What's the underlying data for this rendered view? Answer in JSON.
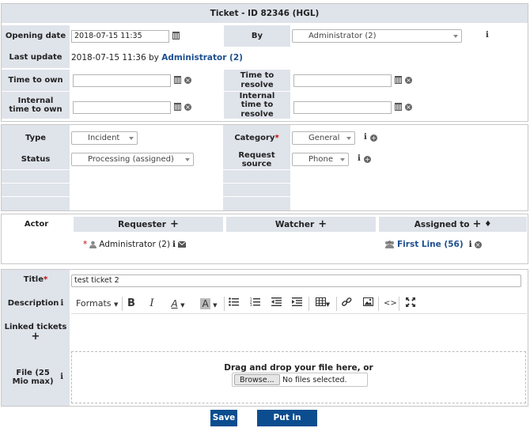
{
  "ticket": {
    "header": "Ticket - ID 82346 (HGL)"
  },
  "dates": {
    "opening_date_label": "Opening date",
    "opening_date_value": "2018-07-15 11:35",
    "by_label": "By",
    "by_value": "Administrator (2)",
    "last_update_label": "Last update",
    "last_update_text": "2018-07-15 11:36 by",
    "last_update_user": "Administrator (2)",
    "time_to_own_label": "Time to own",
    "time_to_resolve_label": "Time to resolve",
    "internal_time_to_own_label": "Internal time to own",
    "internal_time_to_resolve_label": "Internal time to resolve"
  },
  "properties": {
    "type_label": "Type",
    "type_value": "Incident",
    "category_label": "Category",
    "category_value": "General",
    "status_label": "Status",
    "status_value": "Processing (assigned)",
    "request_source_label": "Request source",
    "request_source_value": "Phone"
  },
  "actors": {
    "actor_label": "Actor",
    "requester_label": "Requester",
    "watcher_label": "Watcher",
    "assigned_label": "Assigned to",
    "requester_name": "Administrator (2)",
    "assigned_group": "First Line (56)"
  },
  "content": {
    "title_label": "Title",
    "title_value": "test ticket 2",
    "description_label": "Description",
    "formats_label": "Formats",
    "linked_tickets_label": "Linked tickets",
    "file_label": "File (25 Mio max)",
    "drop_text": "Drag and drop your file here, or",
    "browse_label": "Browse...",
    "no_file_text": "No files selected."
  },
  "actions": {
    "save_label": "Save",
    "dustbin_label": "Put in dustbin"
  },
  "icons": {
    "calendar": "calendar-icon",
    "clear": "clear-icon",
    "info": "info-icon",
    "add": "plus-icon",
    "user": "user-icon",
    "group": "group-icon",
    "mail": "mail-icon"
  },
  "colors": {
    "label_bg": "#dfe3ea",
    "header_bg": "#dfe3ea",
    "link": "#1d4f91",
    "button": "#0c4d8f",
    "required": "#cc0000"
  }
}
